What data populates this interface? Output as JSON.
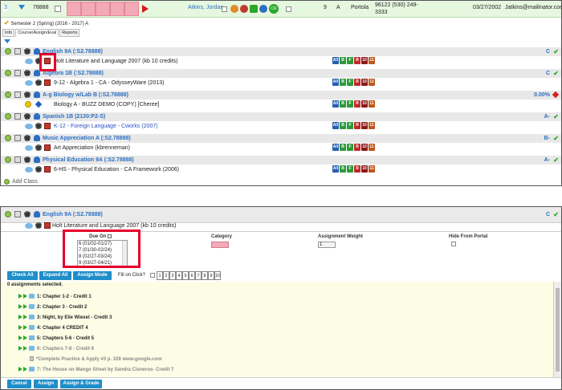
{
  "student": {
    "num": "3",
    "id": "78888",
    "name": "Atkins, Jordan",
    "grade_level": "9",
    "track": "A",
    "school": "Portola",
    "zip_phone": "96122 (530) 249-3333",
    "dob": "03/27/2002",
    "email": "Jatkins@mailinator.com"
  },
  "semester": "Semester 2 (Spring) (2016 - 2017) A",
  "tabs": [
    "Info",
    "Course/Assign/Eval",
    "Reports"
  ],
  "courses": [
    {
      "title": "English 9A (:S2.78888)",
      "grade": "C",
      "sub": "Holt Literature and Language 2007 (kb 10 credits)",
      "sub_link": false,
      "status": "check"
    },
    {
      "title": "Algebra 1B (:S2.78888)",
      "grade": "C",
      "sub": "9-12 - Algebra 1 - CA - OdysseyWare (2013)",
      "sub_link": false,
      "status": "check"
    },
    {
      "title": "A-g Biology w/Lab B (:S2.78888)",
      "grade": "0.00%",
      "sub": "Biology A - BUZZ DEMO (COPY) [Cheree]",
      "sub_link": false,
      "status": "diamond"
    },
    {
      "title": "Spanish 1B (2130:P2-S)",
      "grade": "A-",
      "sub": "K-12 - Foreign Language - Cworks (2007)",
      "sub_link": true,
      "status": "check"
    },
    {
      "title": "Music Appreciation A (:S2.78888)",
      "grade": "B-",
      "sub": "Art Appreciation (kbrenneman)",
      "sub_link": false,
      "status": "check"
    },
    {
      "title": "Physical Education 9A (:S2.78888)",
      "grade": "A-",
      "sub": "6-HS - Physical Education - CA Framework (2006)",
      "sub_link": false,
      "status": "check"
    }
  ],
  "badge_labels": [
    "All",
    "B",
    "F",
    "R",
    "10",
    "11"
  ],
  "add_class": "Add Class",
  "panel2": {
    "course_title": "English 9A (:S2.78888)",
    "course_grade": "C",
    "sub": "Holt Literature and Language 2007 (kb 10 credits)",
    "due_on_label": "Due On",
    "due_options": [
      "6 (01/02-01/27)",
      "7 (01/30-02/24)",
      "8 (02/27-03/24)",
      "9 (03/27-04/21)"
    ],
    "category_label": "Category",
    "weight_label": "Assignment Weight",
    "weight_value": "1",
    "hide_label": "Hide From Portal",
    "buttons": {
      "check_all": "Check All",
      "expand_all": "Expand All",
      "assign_mode": "Assign Mode",
      "cancel": "Cancel",
      "assign": "Assign",
      "assign_grade": "Assign & Grade"
    },
    "fill_label": "Fill on Click?",
    "fill_numbers": [
      "1",
      "2",
      "3",
      "4",
      "5",
      "6",
      "7",
      "8",
      "9",
      "10"
    ],
    "selected_count": "0 assignments selected.",
    "assignments": [
      {
        "label": "1: Chapter 1-2 - Credit 1",
        "grey": false
      },
      {
        "label": "2: Chapter 3 - Credit 2",
        "grey": false
      },
      {
        "label": "3: Night, by Elie Wiesel - Credit 3",
        "grey": false
      },
      {
        "label": "4: Chapter 4 CREDIT 4",
        "grey": false
      },
      {
        "label": "5: Chapters 5-6 - Credit 5",
        "grey": false
      },
      {
        "label": "6: Chapters 7-8 - Credit 6",
        "grey": true
      },
      {
        "label": "7: The House on Mango Street by Sandra Cisneros- Credit 7",
        "grey": true
      }
    ],
    "sub_assignment": "*Complete Practice & Apply #3 p. 326 www.google.com"
  },
  "colors": {
    "accent_blue": "#1f8ec9",
    "link_blue": "#2a6fc4",
    "pink": "#f4a9b6",
    "highlight_red": "#e4002b",
    "green": "#2aa82a"
  }
}
